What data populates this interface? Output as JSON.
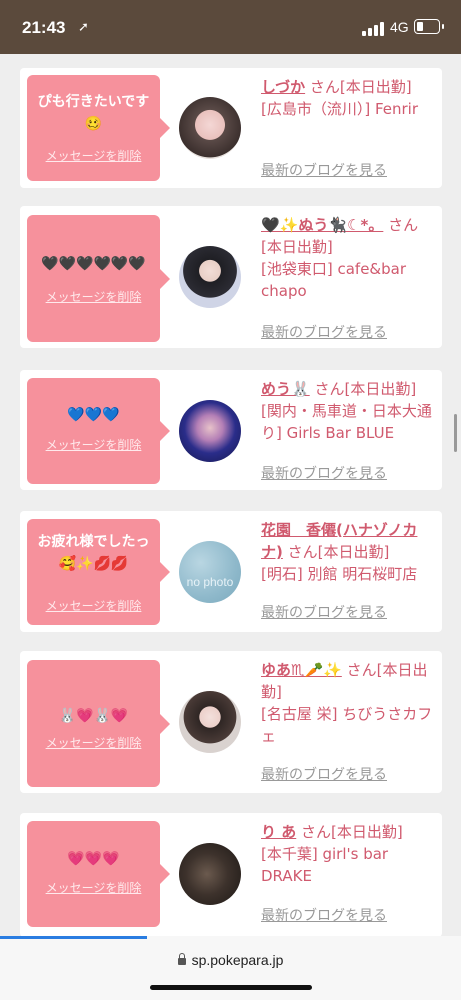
{
  "status_bar": {
    "time": "21:43",
    "network": "4G"
  },
  "cards": [
    {
      "message": "ぴも行きたいです🥴",
      "delete_label": "メッセージを削除",
      "name": "しづか",
      "suffix": "さん[本日出勤]",
      "shop": "[広島市（流川）] Fenrir",
      "blog_label": "最新のブログを見る",
      "avatar": "photo"
    },
    {
      "message": "🖤🖤🖤🖤🖤🖤",
      "delete_label": "メッセージを削除",
      "name": "🖤✨ぬう🐈‍⬛☾*。",
      "suffix": "さん[本日出勤]",
      "shop": "[池袋東口] cafe&bar chapo",
      "blog_label": "最新のブログを見る",
      "avatar": "photo"
    },
    {
      "message": "💙💙💙",
      "delete_label": "メッセージを削除",
      "name": "めう🐰",
      "suffix": "さん[本日出勤]",
      "shop": "[関内・馬車道・日本大通り] Girls Bar BLUE",
      "blog_label": "最新のブログを見る",
      "avatar": "photo"
    },
    {
      "message": "お疲れ様でしたっ🥰✨💋💋",
      "delete_label": "メッセージを削除",
      "name": "花園　香僊(ハナゾノカナ)",
      "suffix": "さん[本日出勤]",
      "shop": "[明石] 別館 明石桜町店",
      "blog_label": "最新のブログを見る",
      "avatar": "no photo"
    },
    {
      "message": "🐰💗🐰💗",
      "delete_label": "メッセージを削除",
      "name": "ゆあ♏︎🥕✨",
      "suffix": "さん[本日出勤]",
      "shop": "[名古屋 栄] ちびうさカフェ",
      "blog_label": "最新のブログを見る",
      "avatar": "photo"
    },
    {
      "message": "💗💗💗",
      "delete_label": "メッセージを削除",
      "name": "り あ",
      "suffix": "さん[本日出勤]",
      "shop": "[本千葉] girl's bar DRAKE",
      "blog_label": "最新のブログを見る",
      "avatar": "photo"
    }
  ],
  "browser": {
    "url": "sp.pokepara.jp"
  }
}
